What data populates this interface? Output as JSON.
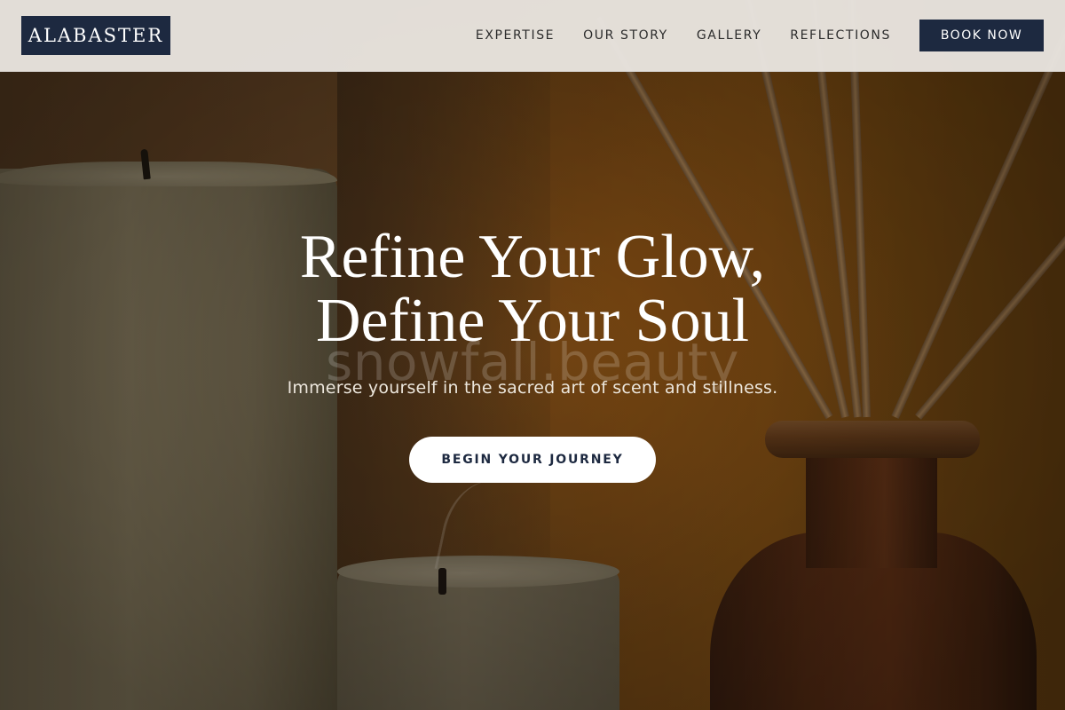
{
  "brand": {
    "logo_text": "ALABASTER"
  },
  "nav": {
    "links": [
      "EXPERTISE",
      "OUR STORY",
      "GALLERY",
      "REFLECTIONS"
    ],
    "cta_label": "BOOK NOW"
  },
  "hero": {
    "title_line1": "Refine Your Glow,",
    "title_line2": "Define Your Soul",
    "watermark": "snowfall.beauty",
    "subtitle": "Immerse yourself in the sacred art of scent and stillness.",
    "cta_label": "BEGIN YOUR JOURNEY",
    "background_image": "candles-and-reed-diffuser"
  },
  "colors": {
    "navy": "#1d2940",
    "nav_bg": "#e9e5e0",
    "white": "#ffffff"
  }
}
